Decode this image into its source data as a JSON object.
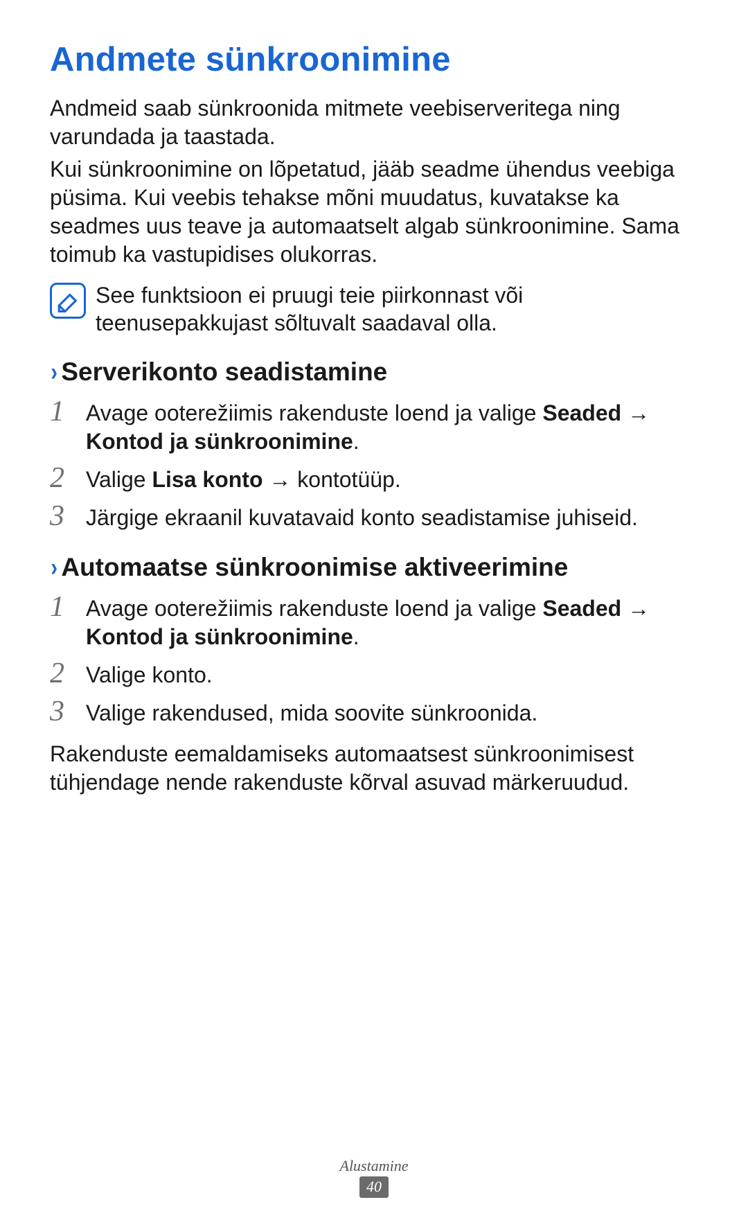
{
  "title": "Andmete sünkroonimine",
  "intro": {
    "p1": "Andmeid saab sünkroonida mitmete veebiserveritega ning varundada ja taastada.",
    "p2": "Kui sünkroonimine on lõpetatud, jääb seadme ühendus veebiga püsima. Kui veebis tehakse mõni muudatus, kuvatakse ka seadmes uus teave ja automaatselt algab sünkroonimine. Sama toimub ka vastupidises olukorras."
  },
  "note": {
    "text": "See funktsioon ei pruugi teie piirkonnast või teenusepakkujast sõltuvalt saadaval olla.",
    "icon_name": "note-icon"
  },
  "chevron": "›",
  "arrow": "→",
  "section1": {
    "heading": "Serverikonto seadistamine",
    "steps": [
      {
        "num": "1",
        "pre": "Avage ooterežiimis rakenduste loend ja valige ",
        "b1": "Seaded",
        "mid": " ",
        "b2": "Kontod ja sünkroonimine",
        "post": "."
      },
      {
        "num": "2",
        "pre": "Valige ",
        "b1": "Lisa konto",
        "mid": " ",
        "post_after_arrow": " kontotüüp."
      },
      {
        "num": "3",
        "plain": "Järgige ekraanil kuvatavaid konto seadistamise juhiseid."
      }
    ]
  },
  "section2": {
    "heading": "Automaatse sünkroonimise aktiveerimine",
    "steps": [
      {
        "num": "1",
        "pre": "Avage ooterežiimis rakenduste loend ja valige ",
        "b1": "Seaded",
        "mid": " ",
        "b2": "Kontod ja sünkroonimine",
        "post": "."
      },
      {
        "num": "2",
        "plain": "Valige konto."
      },
      {
        "num": "3",
        "plain": "Valige rakendused, mida soovite sünkroonida."
      }
    ],
    "closing": "Rakenduste eemaldamiseks automaatsest sünkroonimisest tühjendage nende rakenduste kõrval asuvad märkeruudud."
  },
  "footer": {
    "section_name": "Alustamine",
    "page_number": "40"
  }
}
